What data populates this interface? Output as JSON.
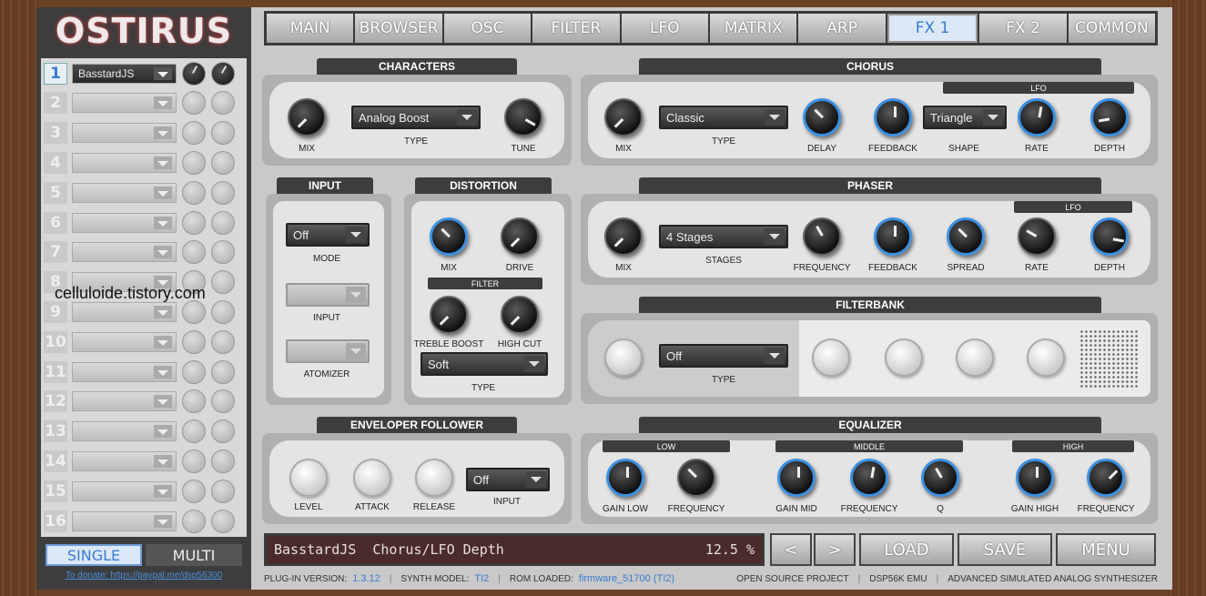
{
  "app": {
    "logo": "OSTIRUS"
  },
  "tabs": [
    {
      "label": "MAIN"
    },
    {
      "label": "BROWSER"
    },
    {
      "label": "OSC"
    },
    {
      "label": "FILTER"
    },
    {
      "label": "LFO"
    },
    {
      "label": "MATRIX"
    },
    {
      "label": "ARP"
    },
    {
      "label": "FX 1"
    },
    {
      "label": "FX 2"
    },
    {
      "label": "COMMON"
    }
  ],
  "active_tab": "FX 1",
  "parts": [
    {
      "num": "1",
      "preset": "BasstardJS"
    },
    {
      "num": "2",
      "preset": ""
    },
    {
      "num": "3",
      "preset": ""
    },
    {
      "num": "4",
      "preset": ""
    },
    {
      "num": "5",
      "preset": ""
    },
    {
      "num": "6",
      "preset": ""
    },
    {
      "num": "7",
      "preset": ""
    },
    {
      "num": "8",
      "preset": ""
    },
    {
      "num": "9",
      "preset": ""
    },
    {
      "num": "10",
      "preset": ""
    },
    {
      "num": "11",
      "preset": ""
    },
    {
      "num": "12",
      "preset": ""
    },
    {
      "num": "13",
      "preset": ""
    },
    {
      "num": "14",
      "preset": ""
    },
    {
      "num": "15",
      "preset": ""
    },
    {
      "num": "16",
      "preset": ""
    }
  ],
  "mode": {
    "single": "SINGLE",
    "multi": "MULTI"
  },
  "donate": "To donate: https://paypal.me/dsp56300",
  "watermark": "celluloide.tistory.com",
  "characters": {
    "title": "CHARACTERS",
    "mix": "MIX",
    "type_label": "TYPE",
    "type_value": "Analog Boost",
    "tune": "TUNE"
  },
  "chorus": {
    "title": "CHORUS",
    "lfo": "LFO",
    "mix": "MIX",
    "type_label": "TYPE",
    "type_value": "Classic",
    "delay": "DELAY",
    "feedback": "FEEDBACK",
    "shape_label": "SHAPE",
    "shape_value": "Triangle",
    "rate": "RATE",
    "depth": "DEPTH"
  },
  "input": {
    "title": "INPUT",
    "mode_value": "Off",
    "mode": "MODE",
    "input": "INPUT",
    "atomizer": "ATOMIZER"
  },
  "distortion": {
    "title": "DISTORTION",
    "mix": "MIX",
    "drive": "DRIVE",
    "filter": "FILTER",
    "treble": "TREBLE BOOST",
    "highcut": "HIGH CUT",
    "type_value": "Soft",
    "type_label": "TYPE"
  },
  "phaser": {
    "title": "PHASER",
    "lfo": "LFO",
    "mix": "MIX",
    "stages_value": "4 Stages",
    "stages": "STAGES",
    "frequency": "FREQUENCY",
    "feedback": "FEEDBACK",
    "spread": "SPREAD",
    "rate": "RATE",
    "depth": "DEPTH"
  },
  "filterbank": {
    "title": "FILTERBANK",
    "type_value": "Off",
    "type_label": "TYPE"
  },
  "envelope": {
    "title": "ENVELOPER FOLLOWER",
    "level": "LEVEL",
    "attack": "ATTACK",
    "release": "RELEASE",
    "input_value": "Off",
    "input": "INPUT"
  },
  "equalizer": {
    "title": "EQUALIZER",
    "low": "LOW",
    "middle": "MIDDLE",
    "high": "HIGH",
    "gain_low": "GAIN LOW",
    "freq_low": "FREQUENCY",
    "gain_mid": "GAIN MID",
    "freq_mid": "FREQUENCY",
    "q": "Q",
    "gain_high": "GAIN HIGH",
    "freq_high": "FREQUENCY"
  },
  "status": {
    "preset": "BasstardJS",
    "param": "Chorus/LFO Depth",
    "value": "12.5 %"
  },
  "buttons": {
    "prev": "<",
    "next": ">",
    "load": "LOAD",
    "save": "SAVE",
    "menu": "MENU"
  },
  "footer": {
    "plugin_label": "PLUG-IN VERSION:",
    "plugin_value": "1.3.12",
    "model_label": "SYNTH MODEL:",
    "model_value": "TI2",
    "rom_label": "ROM LOADED:",
    "rom_value": "firmware_51700 (TI2)",
    "open": "OPEN SOURCE PROJECT",
    "emu": "DSP56K EMU",
    "desc": "ADVANCED SIMULATED ANALOG SYNTHESIZER"
  },
  "colors": {
    "accent": "#3a7bd5",
    "panel": "#b0b0b0",
    "lcd": "#4a2a2a"
  }
}
